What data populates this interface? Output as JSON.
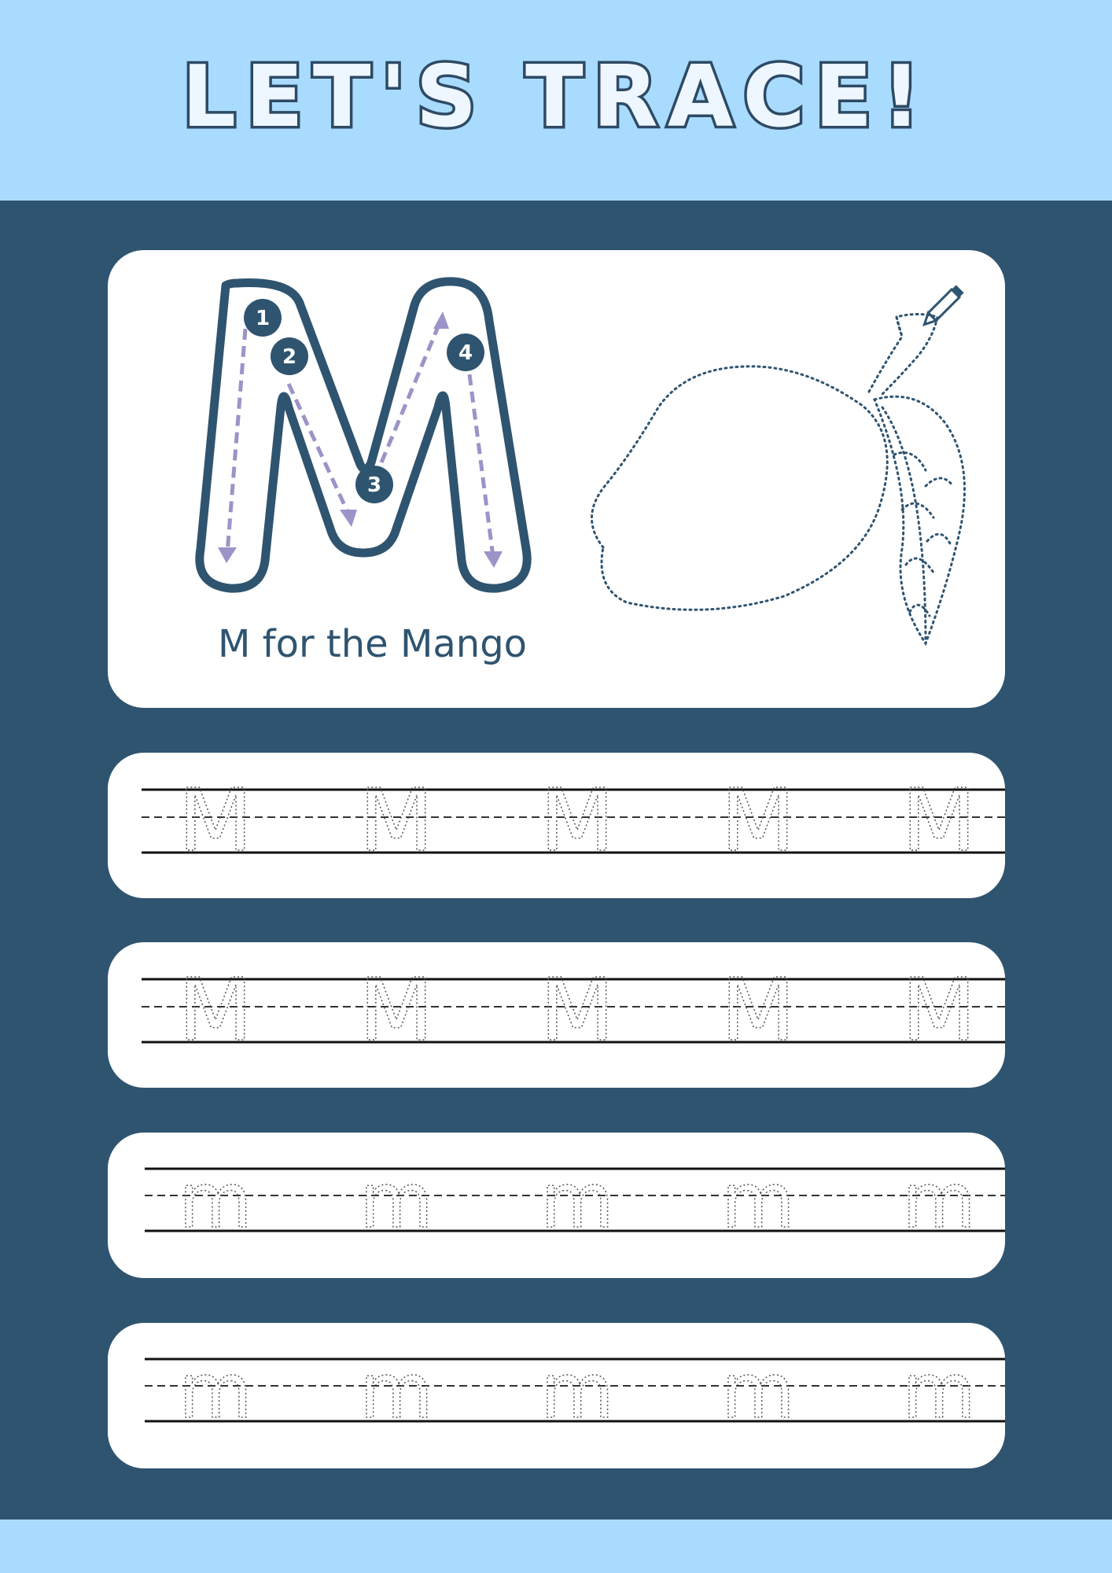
{
  "header": {
    "title": "LET'S TRACE!"
  },
  "hero": {
    "letter": "M",
    "stroke_numbers": [
      "1",
      "2",
      "3",
      "4"
    ],
    "caption": "M for the Mango",
    "icons": [
      "letter-m-outline",
      "pencil-icon",
      "mango-dotted-outline"
    ]
  },
  "practice_rows": [
    {
      "letter": "M",
      "repeat": 5
    },
    {
      "letter": "M",
      "repeat": 5
    },
    {
      "letter": "m",
      "repeat": 5
    },
    {
      "letter": "m",
      "repeat": 5
    }
  ],
  "colors": {
    "header_bg": "#a9dbff",
    "page_bg": "#2f5470",
    "card_bg": "#ffffff",
    "outline": "#2d4a64",
    "guide_arrows": "#9c93c8"
  }
}
